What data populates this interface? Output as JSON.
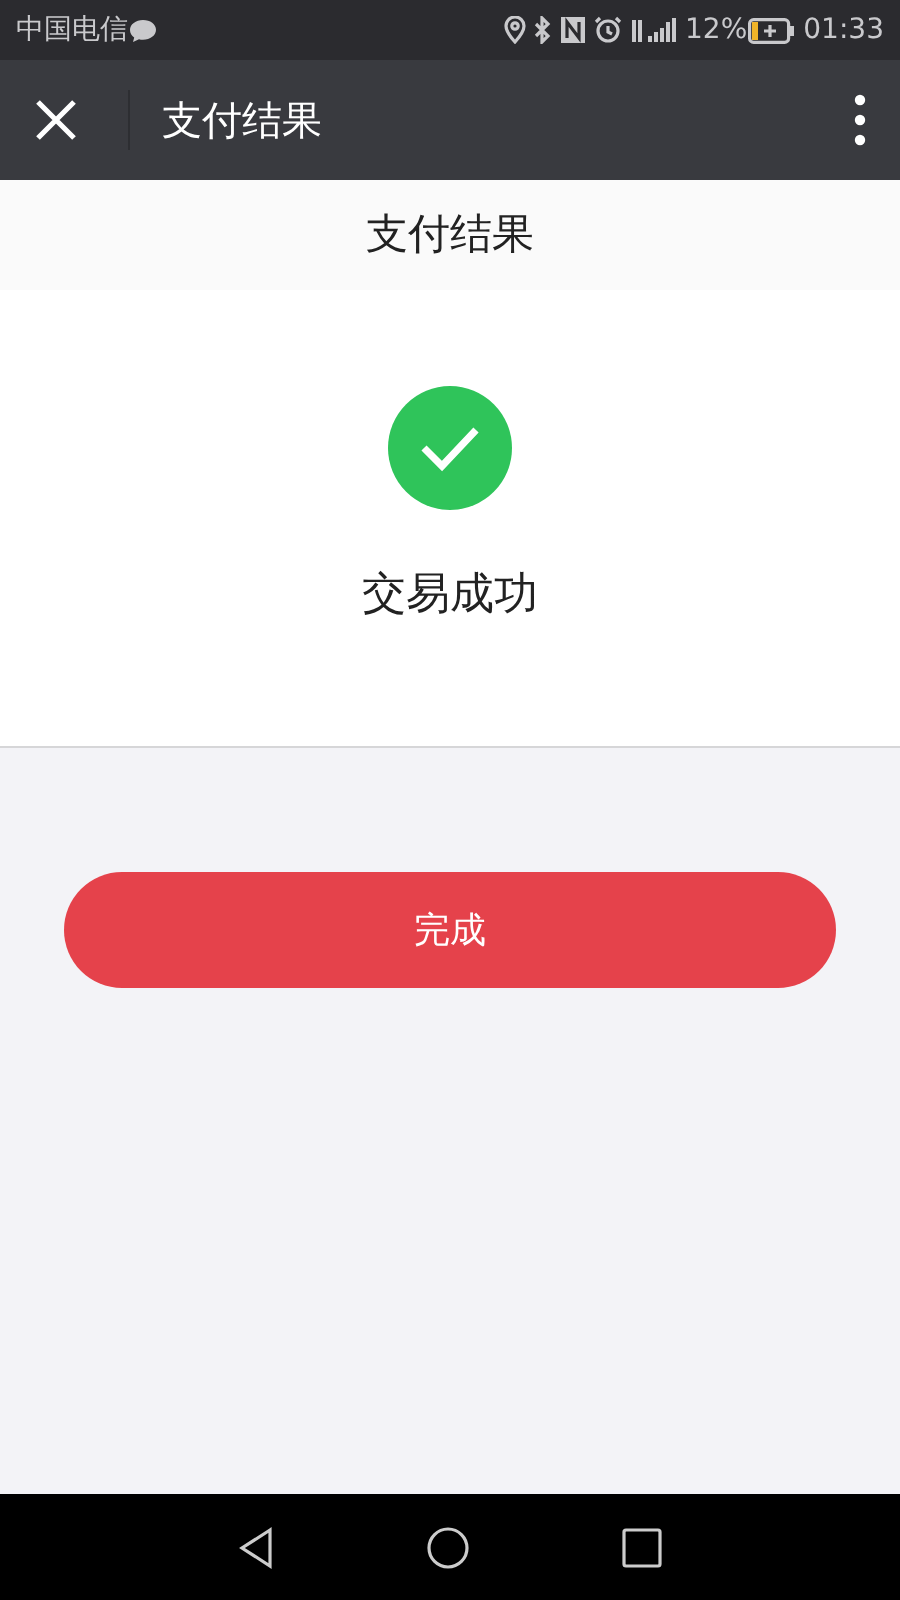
{
  "status_bar": {
    "carrier": "中国电信",
    "battery": "12%",
    "time": "01:33"
  },
  "app_bar": {
    "title": "支付结果"
  },
  "page_header": {
    "title": "支付结果"
  },
  "result": {
    "message": "交易成功"
  },
  "buttons": [
    {
      "label": "完成"
    }
  ]
}
